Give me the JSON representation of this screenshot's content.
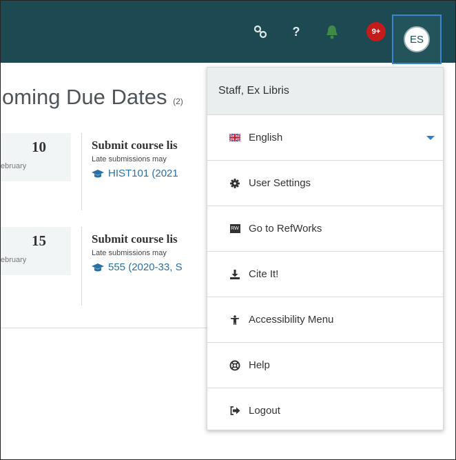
{
  "topbar": {
    "notification_badge": "9+",
    "avatar_initials": "ES",
    "help_glyph": "?",
    "icons": [
      "link-icon",
      "help-icon",
      "bell-icon"
    ]
  },
  "main": {
    "heading": "oming Due Dates",
    "heading_count": "(2)",
    "items": [
      {
        "day": "10",
        "month": "ebruary",
        "title": "Submit course lis",
        "note": "Late submissions may",
        "course": "HIST101 (2021"
      },
      {
        "day": "15",
        "month": "ebruary",
        "title": "Submit course lis",
        "note": "Late submissions may",
        "course": "555 (2020-33, S"
      }
    ]
  },
  "user_menu": {
    "user_name": "Staff, Ex Libris",
    "items": [
      {
        "label": "English",
        "icon": "uk-flag-icon"
      },
      {
        "label": "User Settings",
        "icon": "gear-icon"
      },
      {
        "label": "Go to RefWorks",
        "icon": "refworks-icon",
        "icon_text": "RW"
      },
      {
        "label": "Cite It!",
        "icon": "download-icon"
      },
      {
        "label": "Accessibility Menu",
        "icon": "accessibility-icon"
      },
      {
        "label": "Help",
        "icon": "lifebuoy-icon"
      },
      {
        "label": "Logout",
        "icon": "logout-icon"
      }
    ]
  },
  "colors": {
    "topbar": "#1d4a52",
    "badge": "#c41b1b",
    "accent": "#2f7fd1",
    "link": "#2b6fa3"
  }
}
